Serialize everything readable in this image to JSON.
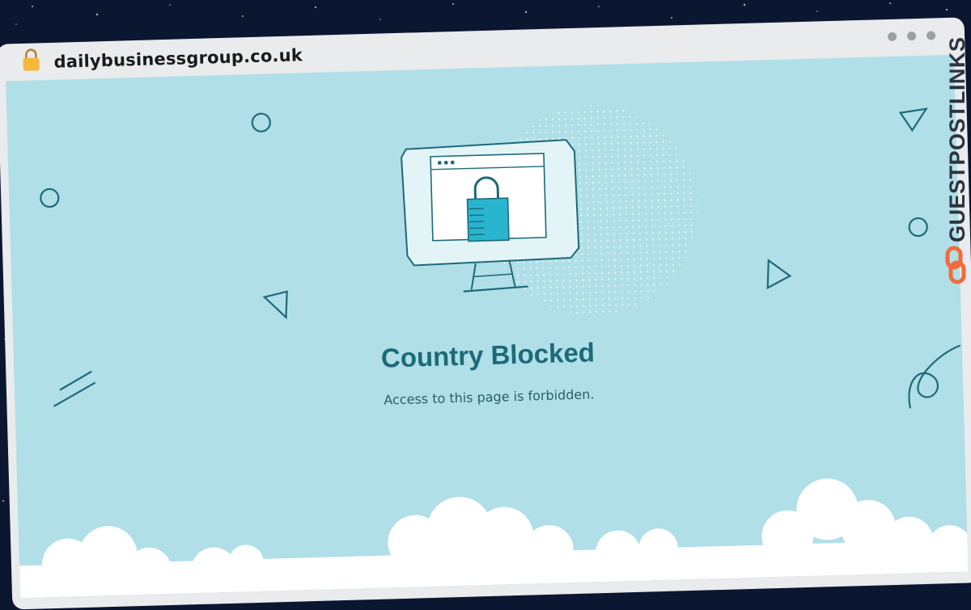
{
  "browser": {
    "url": "dailybusinessgroup.co.uk"
  },
  "page": {
    "title": "Country Blocked",
    "message": "Access to this page is forbidden."
  },
  "watermark": {
    "brand": "GUESTPOSTLINKS"
  },
  "colors": {
    "background": "#0b1630",
    "page_bg": "#b0dfe8",
    "accent": "#1d6a78",
    "lock": "#29b5cf",
    "brand_orange": "#f26a3b"
  }
}
